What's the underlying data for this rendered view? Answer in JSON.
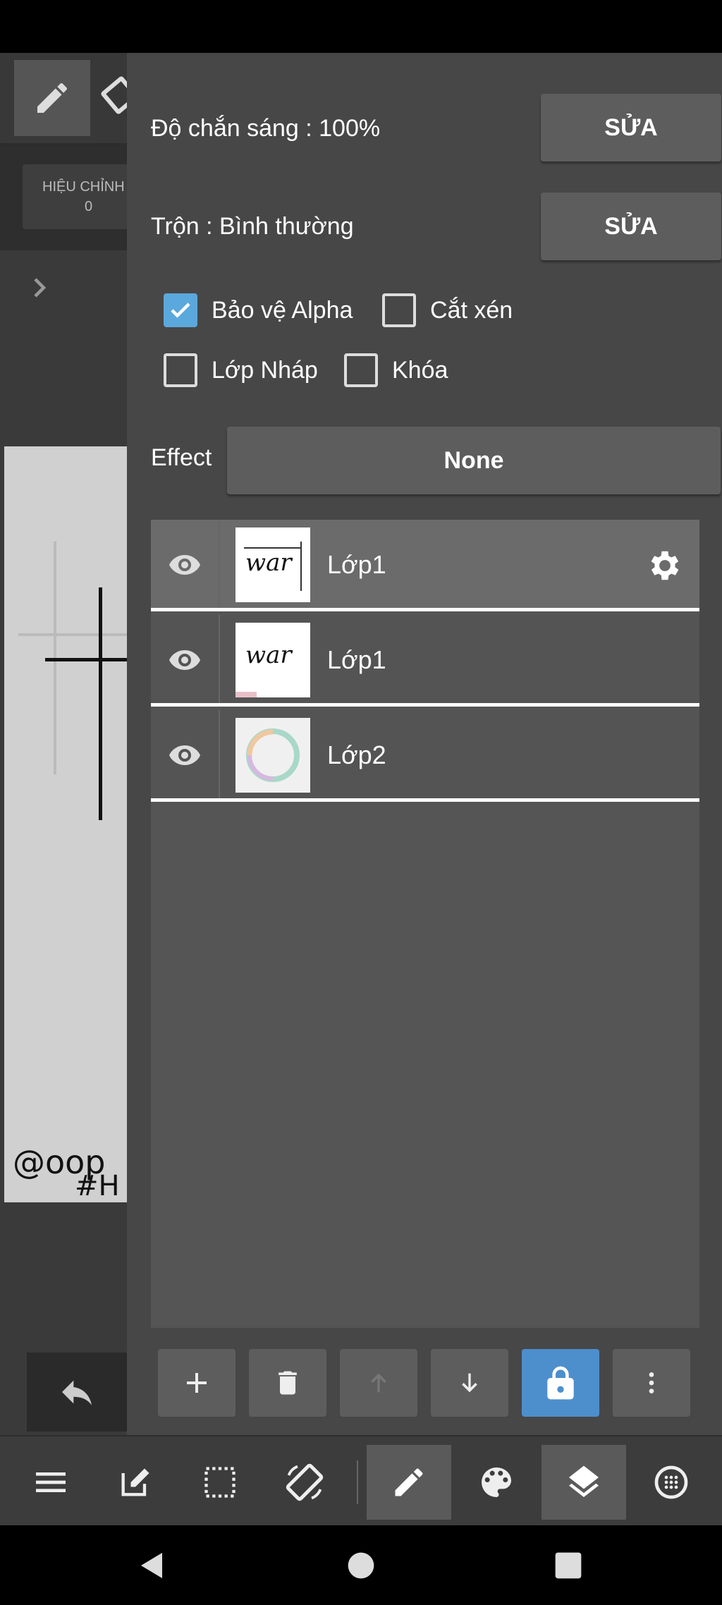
{
  "panel": {
    "opacity_label": "Độ chắn sáng : 100%",
    "opacity_edit": "SỬA",
    "blend_label": "Trộn : Bình thường",
    "blend_edit": "SỬA",
    "checkboxes": [
      {
        "label": "Bảo vệ Alpha",
        "checked": true
      },
      {
        "label": "Cắt xén",
        "checked": false
      },
      {
        "label": "Lớp Nháp",
        "checked": false
      },
      {
        "label": "Khóa",
        "checked": false
      }
    ],
    "effect_label": "Effect",
    "effect_value": "None",
    "layers": [
      {
        "name": "Lớp1",
        "selected": true,
        "visible": true,
        "thumb_text": "war"
      },
      {
        "name": "Lớp1",
        "selected": false,
        "visible": true,
        "thumb_text": "war"
      },
      {
        "name": "Lớp2",
        "selected": false,
        "visible": true,
        "thumb_text": ""
      }
    ],
    "layer_tools": [
      "add-icon",
      "trash-icon",
      "arrow-up-icon",
      "arrow-down-icon",
      "lock-icon",
      "more-vert-icon"
    ]
  },
  "background": {
    "correction_label": "HIỆU CHỈNH",
    "correction_value": "0",
    "canvas_text_1": "@oop",
    "canvas_text_2": "#H"
  },
  "bottom_toolbar": [
    "menu-icon",
    "edit-icon",
    "selection-icon",
    "rotate-icon",
    "pen-icon",
    "palette-icon",
    "layers-icon",
    "grid-icon"
  ],
  "nav": [
    "back-icon",
    "home-icon",
    "recents-icon"
  ],
  "colors": {
    "accent": "#4d8fcc",
    "check": "#5ba8dc",
    "panel": "#474747"
  }
}
